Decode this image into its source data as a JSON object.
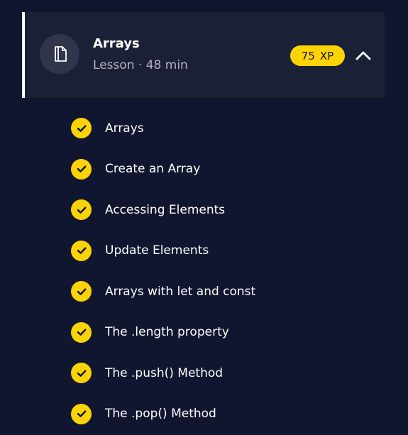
{
  "lesson": {
    "title": "Arrays",
    "meta": "Lesson · 48 min",
    "xp_value": "75",
    "xp_unit": "XP",
    "icon": "document-icon",
    "collapse_icon": "chevron-up-icon"
  },
  "items": [
    {
      "label": "Arrays",
      "completed": true
    },
    {
      "label": "Create an Array",
      "completed": true
    },
    {
      "label": "Accessing Elements",
      "completed": true
    },
    {
      "label": "Update Elements",
      "completed": true
    },
    {
      "label": "Arrays with let and const",
      "completed": true
    },
    {
      "label": "The .length property",
      "completed": true
    },
    {
      "label": "The .push() Method",
      "completed": true
    },
    {
      "label": "The .pop() Method",
      "completed": true
    }
  ],
  "colors": {
    "background": "#10162f",
    "card": "#1a2036",
    "accent": "#ffd300",
    "text": "#ffffff",
    "muted_text": "#b1b5c3"
  }
}
